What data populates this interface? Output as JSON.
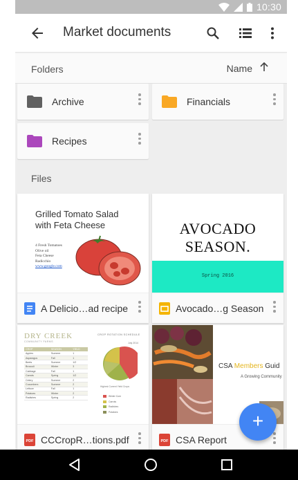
{
  "status_bar": {
    "time": "10:30"
  },
  "app_bar": {
    "title": "Market documents",
    "back_icon": "arrow-back-icon",
    "search_icon": "search-icon",
    "list_view_icon": "list-view-icon",
    "more_icon": "more-vert-icon"
  },
  "header": {
    "folders_label": "Folders",
    "sort_label": "Name",
    "sort_icon": "arrow-up-icon"
  },
  "folders": [
    {
      "name": "Archive",
      "color": "#616161"
    },
    {
      "name": "Financials",
      "color": "#f9a825"
    },
    {
      "name": "Recipes",
      "color": "#ab47bc"
    }
  ],
  "files_label": "Files",
  "files": [
    {
      "name": "A Delicio…ad recipe",
      "type_icon": "google-docs-icon",
      "type_color": "#4285f4",
      "thumb": {
        "title_line1": "Grilled Tomato Salad",
        "title_line2": "with Feta Cheese",
        "list": [
          "4 Fresh Tomatoes",
          "Olive oil",
          "Feta Cheese",
          "Radicchio",
          "www.google.com"
        ]
      }
    },
    {
      "name": "Avocado…g Season",
      "type_icon": "google-slides-icon",
      "type_color": "#f4b400",
      "thumb": {
        "title": "AVOCADO SEASON.",
        "band_text": "Spring 2016",
        "band_color": "#1de9c4"
      }
    },
    {
      "name": "CCCropR…tions.pdf",
      "type_icon": "pdf-icon",
      "type_color": "#db4437",
      "thumb": {
        "brand": "DRY CREEK",
        "brand_sub": "COMMUNITY FARMS",
        "chart_heading": "CROP ROTATION SCHEDULE",
        "date": "July 2014",
        "chart_caption": "Highest Current Yield Crops",
        "table_headers": [
          "CROP",
          "SEASON",
          "YIELD"
        ],
        "table_rows": [
          [
            "Apples",
            "Summer",
            "1"
          ],
          [
            "Asparagus",
            "Fall",
            "1"
          ],
          [
            "Beets",
            "Summer",
            "1/2"
          ],
          [
            "Broccoli",
            "Winter",
            "3"
          ],
          [
            "Cabbage",
            "Fall",
            "1"
          ],
          [
            "Carrots",
            "Spring",
            "1/2"
          ],
          [
            "Celery",
            "Summer",
            "2"
          ],
          [
            "Cucumbers",
            "Summer",
            "2"
          ],
          [
            "Lettuce",
            "Fall",
            "1"
          ],
          [
            "Potatoes",
            "Winter",
            "2"
          ],
          [
            "Radishes",
            "Spring",
            "2"
          ]
        ],
        "legend": [
          "Winter Corn",
          "Carrots",
          "Radishes",
          "Potatoes"
        ],
        "legend_colors": [
          "#d9534f",
          "#d4c24a",
          "#9fb24a",
          "#8b8f5a"
        ]
      }
    },
    {
      "name": "CSA Report",
      "type_icon": "pdf-icon",
      "type_color": "#db4437",
      "thumb": {
        "title_pre": "CSA ",
        "title_hl": "Members",
        "title_post": " Guid",
        "subtitle": "A Growing Community"
      }
    }
  ],
  "fab": {
    "icon": "add-icon",
    "label": "+"
  },
  "nav_bar": {
    "back_icon": "nav-back-icon",
    "home_icon": "nav-home-icon",
    "recents_icon": "nav-recents-icon"
  }
}
